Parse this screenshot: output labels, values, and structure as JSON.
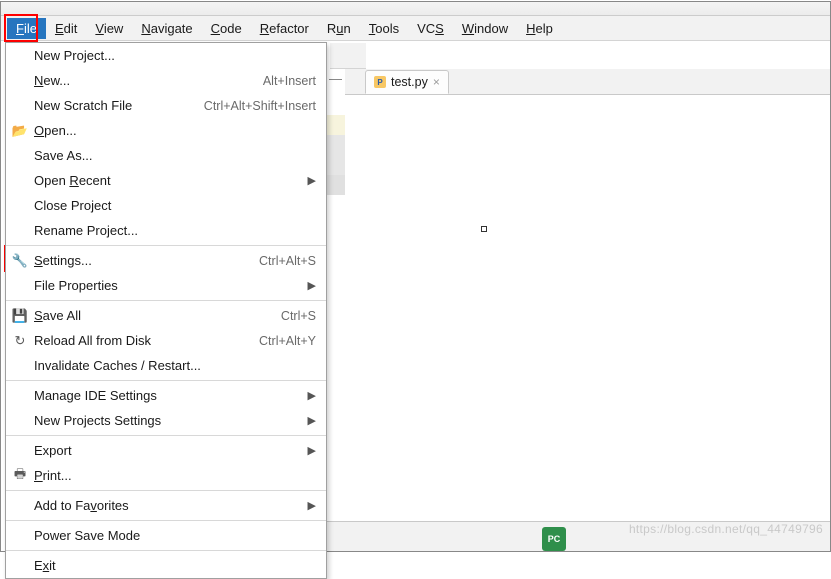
{
  "menubar": {
    "file": {
      "label": "File",
      "mn": "F"
    },
    "edit": {
      "label": "Edit",
      "mn": "E"
    },
    "view": {
      "label": "View",
      "mn": "V"
    },
    "navigate": {
      "label": "Navigate",
      "mn": "N"
    },
    "code": {
      "label": "Code",
      "mn": "C"
    },
    "refactor": {
      "label": "Refactor",
      "mn": "R"
    },
    "run": {
      "label": "Run",
      "mn": "u"
    },
    "tools": {
      "label": "Tools",
      "mn": "T"
    },
    "vcs": {
      "label": "VCS",
      "mn": "S"
    },
    "window": {
      "label": "Window",
      "mn": "W"
    },
    "help": {
      "label": "Help",
      "mn": "H"
    }
  },
  "file_menu": {
    "new_project": {
      "label": "New Project..."
    },
    "new": {
      "label": "New...",
      "mn": "N",
      "shortcut": "Alt+Insert"
    },
    "new_scratch": {
      "label": "New Scratch File",
      "shortcut": "Ctrl+Alt+Shift+Insert"
    },
    "open": {
      "label": "Open...",
      "mn": "O",
      "icon": "folder"
    },
    "save_as": {
      "label": "Save As..."
    },
    "open_recent": {
      "label": "Open Recent",
      "mn": "R",
      "sub": true
    },
    "close_project": {
      "label": "Close Project"
    },
    "rename_project": {
      "label": "Rename Project..."
    },
    "settings": {
      "label": "Settings...",
      "mn": "S",
      "shortcut": "Ctrl+Alt+S",
      "icon": "wrench"
    },
    "file_props": {
      "label": "File Properties",
      "sub": true
    },
    "save_all": {
      "label": "Save All",
      "mn": "S",
      "shortcut": "Ctrl+S",
      "icon": "save"
    },
    "reload": {
      "label": "Reload All from Disk",
      "shortcut": "Ctrl+Alt+Y",
      "icon": "reload"
    },
    "invalidate": {
      "label": "Invalidate Caches / Restart..."
    },
    "manage_ide": {
      "label": "Manage IDE Settings",
      "sub": true
    },
    "new_proj_set": {
      "label": "New Projects Settings",
      "sub": true
    },
    "export": {
      "label": "Export",
      "sub": true
    },
    "print": {
      "label": "Print...",
      "mn": "P",
      "icon": "print"
    },
    "add_fav": {
      "label": "Add to Favorites",
      "mn": "v",
      "sub": true
    },
    "power_save": {
      "label": "Power Save Mode"
    },
    "exit": {
      "label": "Exit",
      "mn": "x"
    }
  },
  "editor": {
    "tab_label": "test.py",
    "minimize_glyph": "—"
  },
  "icons": {
    "folder": "📂",
    "wrench": "🔧",
    "save": "💾",
    "reload": "↻",
    "print": "🖶",
    "submenu": "▶",
    "close": "×"
  },
  "status": {
    "ide_badge": "PC"
  },
  "watermark": "https://blog.csdn.net/qq_44749796"
}
